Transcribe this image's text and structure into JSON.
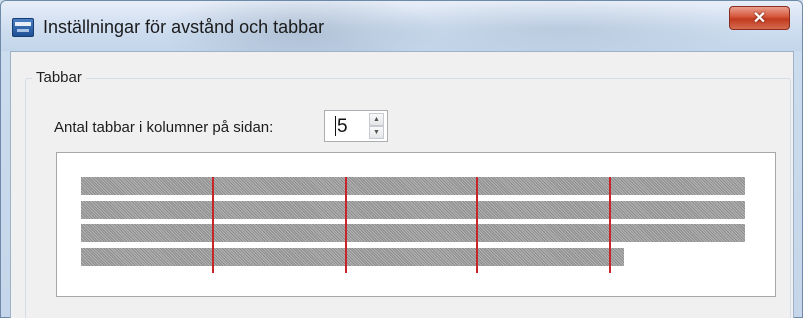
{
  "window": {
    "title": "Inställningar för avstånd och tabbar",
    "close_glyph": "✕"
  },
  "group": {
    "title": "Tabbar",
    "tab_count_label": "Antal tabbar i kolumner på sidan:",
    "tab_count_value": "5",
    "spin_up_glyph": "▲",
    "spin_down_glyph": "▼"
  },
  "preview": {
    "line_count": 4,
    "tab_columns": 5
  },
  "icons": {
    "app": "app-icon",
    "close": "close-icon",
    "spin_up": "spin-up-icon",
    "spin_down": "spin-down-icon"
  },
  "colors": {
    "tab_marker": "#c8242a",
    "close_button": "#c94a30"
  }
}
